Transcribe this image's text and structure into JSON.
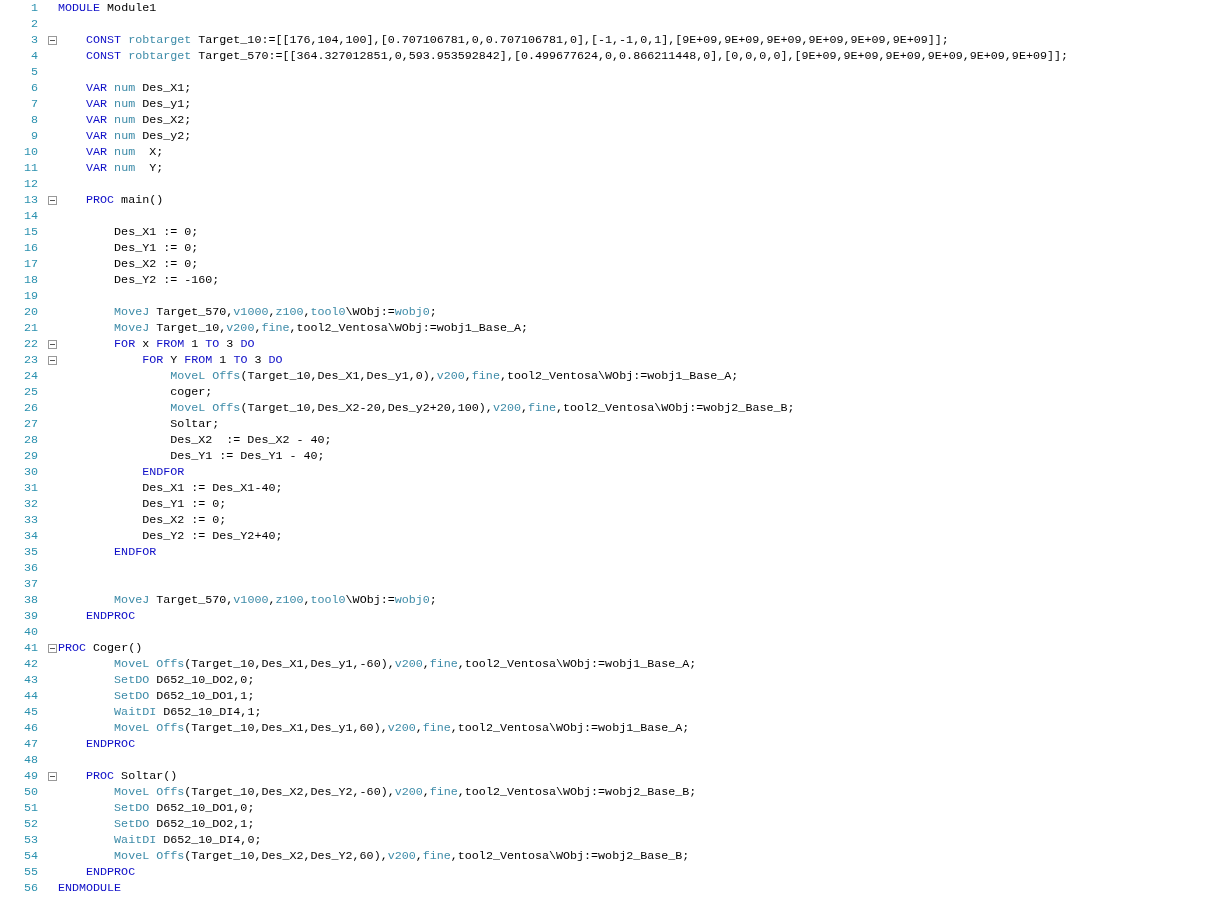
{
  "editor": {
    "lines": [
      {
        "number": "1",
        "fold": false,
        "tokens": [
          {
            "text": "MODULE",
            "kind": "keyword"
          },
          {
            "text": " Module1",
            "kind": "plain"
          }
        ]
      },
      {
        "number": "2",
        "fold": false
      },
      {
        "number": "3",
        "fold": true,
        "tokens": [
          {
            "text": "    CONST",
            "kind": "keyword"
          },
          {
            "text": " robtarget",
            "kind": "builtin"
          },
          {
            "text": " Target_10:=[[176,104,100],[0.707106781,0,0.707106781,0],[-1,-1,0,1],[9E+09,9E+09,9E+09,9E+09,9E+09,9E+09]];",
            "kind": "plain"
          }
        ]
      },
      {
        "number": "4",
        "fold": false,
        "tokens": [
          {
            "text": "    CONST",
            "kind": "keyword"
          },
          {
            "text": " robtarget",
            "kind": "builtin"
          },
          {
            "text": " Target_570:=[[364.327012851,0,593.953592842],[0.499677624,0,0.866211448,0],[0,0,0,0],[9E+09,9E+09,9E+09,9E+09,9E+09,9E+09]];",
            "kind": "plain"
          }
        ]
      },
      {
        "number": "5",
        "fold": false
      },
      {
        "number": "6",
        "fold": false,
        "tokens": [
          {
            "text": "    VAR",
            "kind": "keyword"
          },
          {
            "text": " num",
            "kind": "builtin"
          },
          {
            "text": " Des_X1;",
            "kind": "plain"
          }
        ]
      },
      {
        "number": "7",
        "fold": false,
        "tokens": [
          {
            "text": "    VAR",
            "kind": "keyword"
          },
          {
            "text": " num",
            "kind": "builtin"
          },
          {
            "text": " Des_y1;",
            "kind": "plain"
          }
        ]
      },
      {
        "number": "8",
        "fold": false,
        "tokens": [
          {
            "text": "    VAR",
            "kind": "keyword"
          },
          {
            "text": " num",
            "kind": "builtin"
          },
          {
            "text": " Des_X2;",
            "kind": "plain"
          }
        ]
      },
      {
        "number": "9",
        "fold": false,
        "tokens": [
          {
            "text": "    VAR",
            "kind": "keyword"
          },
          {
            "text": " num",
            "kind": "builtin"
          },
          {
            "text": " Des_y2;",
            "kind": "plain"
          }
        ]
      },
      {
        "number": "10",
        "fold": false,
        "tokens": [
          {
            "text": "    VAR",
            "kind": "keyword"
          },
          {
            "text": " num",
            "kind": "builtin"
          },
          {
            "text": "  X;",
            "kind": "plain"
          }
        ]
      },
      {
        "number": "11",
        "fold": false,
        "tokens": [
          {
            "text": "    VAR",
            "kind": "keyword"
          },
          {
            "text": " num",
            "kind": "builtin"
          },
          {
            "text": "  Y;",
            "kind": "plain"
          }
        ]
      },
      {
        "number": "12",
        "fold": false
      },
      {
        "number": "13",
        "fold": true,
        "tokens": [
          {
            "text": "    PROC",
            "kind": "keyword"
          },
          {
            "text": " main()",
            "kind": "plain"
          }
        ]
      },
      {
        "number": "14",
        "fold": false
      },
      {
        "number": "15",
        "fold": false,
        "tokens": [
          {
            "text": "        Des_X1 := 0;",
            "kind": "plain"
          }
        ]
      },
      {
        "number": "16",
        "fold": false,
        "tokens": [
          {
            "text": "        Des_Y1 := 0;",
            "kind": "plain"
          }
        ]
      },
      {
        "number": "17",
        "fold": false,
        "tokens": [
          {
            "text": "        Des_X2 := 0;",
            "kind": "plain"
          }
        ]
      },
      {
        "number": "18",
        "fold": false,
        "tokens": [
          {
            "text": "        Des_Y2 := -160;",
            "kind": "plain"
          }
        ]
      },
      {
        "number": "19",
        "fold": false
      },
      {
        "number": "20",
        "fold": false,
        "tokens": [
          {
            "text": "        MoveJ",
            "kind": "builtin"
          },
          {
            "text": " Target_570,",
            "kind": "plain"
          },
          {
            "text": "v1000",
            "kind": "builtin"
          },
          {
            "text": ",",
            "kind": "plain"
          },
          {
            "text": "z100",
            "kind": "builtin"
          },
          {
            "text": ",",
            "kind": "plain"
          },
          {
            "text": "tool0",
            "kind": "builtin"
          },
          {
            "text": "\\WObj:=",
            "kind": "plain"
          },
          {
            "text": "wobj0",
            "kind": "builtin"
          },
          {
            "text": ";",
            "kind": "plain"
          }
        ]
      },
      {
        "number": "21",
        "fold": false,
        "tokens": [
          {
            "text": "        MoveJ",
            "kind": "builtin"
          },
          {
            "text": " Target_10,",
            "kind": "plain"
          },
          {
            "text": "v200",
            "kind": "builtin"
          },
          {
            "text": ",",
            "kind": "plain"
          },
          {
            "text": "fine",
            "kind": "builtin"
          },
          {
            "text": ",tool2_Ventosa\\WObj:=wobj1_Base_A;",
            "kind": "plain"
          }
        ]
      },
      {
        "number": "22",
        "fold": true,
        "tokens": [
          {
            "text": "        FOR",
            "kind": "keyword"
          },
          {
            "text": " x ",
            "kind": "plain"
          },
          {
            "text": "FROM",
            "kind": "keyword"
          },
          {
            "text": " 1 ",
            "kind": "plain"
          },
          {
            "text": "TO",
            "kind": "keyword"
          },
          {
            "text": " 3 ",
            "kind": "plain"
          },
          {
            "text": "DO",
            "kind": "keyword"
          }
        ]
      },
      {
        "number": "23",
        "fold": true,
        "tokens": [
          {
            "text": "            FOR",
            "kind": "keyword"
          },
          {
            "text": " Y ",
            "kind": "plain"
          },
          {
            "text": "FROM",
            "kind": "keyword"
          },
          {
            "text": " 1 ",
            "kind": "plain"
          },
          {
            "text": "TO",
            "kind": "keyword"
          },
          {
            "text": " 3 ",
            "kind": "plain"
          },
          {
            "text": "DO",
            "kind": "keyword"
          }
        ]
      },
      {
        "number": "24",
        "fold": false,
        "tokens": [
          {
            "text": "                MoveL",
            "kind": "builtin"
          },
          {
            "text": " Offs",
            "kind": "builtin"
          },
          {
            "text": "(Target_10,Des_X1,Des_y1,0),",
            "kind": "plain"
          },
          {
            "text": "v200",
            "kind": "builtin"
          },
          {
            "text": ",",
            "kind": "plain"
          },
          {
            "text": "fine",
            "kind": "builtin"
          },
          {
            "text": ",tool2_Ventosa\\WObj:=wobj1_Base_A;",
            "kind": "plain"
          }
        ]
      },
      {
        "number": "25",
        "fold": false,
        "tokens": [
          {
            "text": "                coger;",
            "kind": "plain"
          }
        ]
      },
      {
        "number": "26",
        "fold": false,
        "tokens": [
          {
            "text": "                MoveL",
            "kind": "builtin"
          },
          {
            "text": " Offs",
            "kind": "builtin"
          },
          {
            "text": "(Target_10,Des_X2-20,Des_y2+20,100),",
            "kind": "plain"
          },
          {
            "text": "v200",
            "kind": "builtin"
          },
          {
            "text": ",",
            "kind": "plain"
          },
          {
            "text": "fine",
            "kind": "builtin"
          },
          {
            "text": ",tool2_Ventosa\\WObj:=wobj2_Base_B;",
            "kind": "plain"
          }
        ]
      },
      {
        "number": "27",
        "fold": false,
        "tokens": [
          {
            "text": "                Soltar;",
            "kind": "plain"
          }
        ]
      },
      {
        "number": "28",
        "fold": false,
        "tokens": [
          {
            "text": "                Des_X2  := Des_X2 - 40;",
            "kind": "plain"
          }
        ]
      },
      {
        "number": "29",
        "fold": false,
        "tokens": [
          {
            "text": "                Des_Y1 := Des_Y1 - 40;",
            "kind": "plain"
          }
        ]
      },
      {
        "number": "30",
        "fold": false,
        "tokens": [
          {
            "text": "            ENDFOR",
            "kind": "keyword"
          }
        ]
      },
      {
        "number": "31",
        "fold": false,
        "tokens": [
          {
            "text": "            Des_X1 := Des_X1-40;",
            "kind": "plain"
          }
        ]
      },
      {
        "number": "32",
        "fold": false,
        "tokens": [
          {
            "text": "            Des_Y1 := 0;",
            "kind": "plain"
          }
        ]
      },
      {
        "number": "33",
        "fold": false,
        "tokens": [
          {
            "text": "            Des_X2 := 0;",
            "kind": "plain"
          }
        ]
      },
      {
        "number": "34",
        "fold": false,
        "tokens": [
          {
            "text": "            Des_Y2 := Des_Y2+40;",
            "kind": "plain"
          }
        ]
      },
      {
        "number": "35",
        "fold": false,
        "tokens": [
          {
            "text": "        ENDFOR",
            "kind": "keyword"
          }
        ]
      },
      {
        "number": "36",
        "fold": false
      },
      {
        "number": "37",
        "fold": false
      },
      {
        "number": "38",
        "fold": false,
        "tokens": [
          {
            "text": "        MoveJ",
            "kind": "builtin"
          },
          {
            "text": " Target_570,",
            "kind": "plain"
          },
          {
            "text": "v1000",
            "kind": "builtin"
          },
          {
            "text": ",",
            "kind": "plain"
          },
          {
            "text": "z100",
            "kind": "builtin"
          },
          {
            "text": ",",
            "kind": "plain"
          },
          {
            "text": "tool0",
            "kind": "builtin"
          },
          {
            "text": "\\WObj:=",
            "kind": "plain"
          },
          {
            "text": "wobj0",
            "kind": "builtin"
          },
          {
            "text": ";",
            "kind": "plain"
          }
        ]
      },
      {
        "number": "39",
        "fold": false,
        "tokens": [
          {
            "text": "    ENDPROC",
            "kind": "keyword"
          }
        ]
      },
      {
        "number": "40",
        "fold": false
      },
      {
        "number": "41",
        "fold": true,
        "tokens": [
          {
            "text": "PROC",
            "kind": "keyword"
          },
          {
            "text": " Coger()",
            "kind": "plain"
          }
        ]
      },
      {
        "number": "42",
        "fold": false,
        "tokens": [
          {
            "text": "        MoveL",
            "kind": "builtin"
          },
          {
            "text": " Offs",
            "kind": "builtin"
          },
          {
            "text": "(Target_10,Des_X1,Des_y1,-60),",
            "kind": "plain"
          },
          {
            "text": "v200",
            "kind": "builtin"
          },
          {
            "text": ",",
            "kind": "plain"
          },
          {
            "text": "fine",
            "kind": "builtin"
          },
          {
            "text": ",tool2_Ventosa\\WObj:=wobj1_Base_A;",
            "kind": "plain"
          }
        ]
      },
      {
        "number": "43",
        "fold": false,
        "tokens": [
          {
            "text": "        SetDO",
            "kind": "builtin"
          },
          {
            "text": " D652_10_DO2,0;",
            "kind": "plain"
          }
        ]
      },
      {
        "number": "44",
        "fold": false,
        "tokens": [
          {
            "text": "        SetDO",
            "kind": "builtin"
          },
          {
            "text": " D652_10_DO1,1;",
            "kind": "plain"
          }
        ]
      },
      {
        "number": "45",
        "fold": false,
        "tokens": [
          {
            "text": "        WaitDI",
            "kind": "builtin"
          },
          {
            "text": " D652_10_DI4,1;",
            "kind": "plain"
          }
        ]
      },
      {
        "number": "46",
        "fold": false,
        "tokens": [
          {
            "text": "        MoveL",
            "kind": "builtin"
          },
          {
            "text": " Offs",
            "kind": "builtin"
          },
          {
            "text": "(Target_10,Des_X1,Des_y1,60),",
            "kind": "plain"
          },
          {
            "text": "v200",
            "kind": "builtin"
          },
          {
            "text": ",",
            "kind": "plain"
          },
          {
            "text": "fine",
            "kind": "builtin"
          },
          {
            "text": ",tool2_Ventosa\\WObj:=wobj1_Base_A;",
            "kind": "plain"
          }
        ]
      },
      {
        "number": "47",
        "fold": false,
        "tokens": [
          {
            "text": "    ENDPROC",
            "kind": "keyword"
          }
        ]
      },
      {
        "number": "48",
        "fold": false
      },
      {
        "number": "49",
        "fold": true,
        "tokens": [
          {
            "text": "    PROC",
            "kind": "keyword"
          },
          {
            "text": " Soltar()",
            "kind": "plain"
          }
        ]
      },
      {
        "number": "50",
        "fold": false,
        "tokens": [
          {
            "text": "        MoveL",
            "kind": "builtin"
          },
          {
            "text": " Offs",
            "kind": "builtin"
          },
          {
            "text": "(Target_10,Des_X2,Des_Y2,-60),",
            "kind": "plain"
          },
          {
            "text": "v200",
            "kind": "builtin"
          },
          {
            "text": ",",
            "kind": "plain"
          },
          {
            "text": "fine",
            "kind": "builtin"
          },
          {
            "text": ",tool2_Ventosa\\WObj:=wobj2_Base_B;",
            "kind": "plain"
          }
        ]
      },
      {
        "number": "51",
        "fold": false,
        "tokens": [
          {
            "text": "        SetDO",
            "kind": "builtin"
          },
          {
            "text": " D652_10_DO1,0;",
            "kind": "plain"
          }
        ]
      },
      {
        "number": "52",
        "fold": false,
        "tokens": [
          {
            "text": "        SetDO",
            "kind": "builtin"
          },
          {
            "text": " D652_10_DO2,1;",
            "kind": "plain"
          }
        ]
      },
      {
        "number": "53",
        "fold": false,
        "tokens": [
          {
            "text": "        WaitDI",
            "kind": "builtin"
          },
          {
            "text": " D652_10_DI4,0;",
            "kind": "plain"
          }
        ]
      },
      {
        "number": "54",
        "fold": false,
        "tokens": [
          {
            "text": "        MoveL",
            "kind": "builtin"
          },
          {
            "text": " Offs",
            "kind": "builtin"
          },
          {
            "text": "(Target_10,Des_X2,Des_Y2,60),",
            "kind": "plain"
          },
          {
            "text": "v200",
            "kind": "builtin"
          },
          {
            "text": ",",
            "kind": "plain"
          },
          {
            "text": "fine",
            "kind": "builtin"
          },
          {
            "text": ",tool2_Ventosa\\WObj:=wobj2_Base_B;",
            "kind": "plain"
          }
        ]
      },
      {
        "number": "55",
        "fold": false,
        "tokens": [
          {
            "text": "    ENDPROC",
            "kind": "keyword"
          }
        ]
      },
      {
        "number": "56",
        "fold": false,
        "tokens": [
          {
            "text": "ENDMODULE",
            "kind": "keyword"
          }
        ]
      }
    ]
  }
}
